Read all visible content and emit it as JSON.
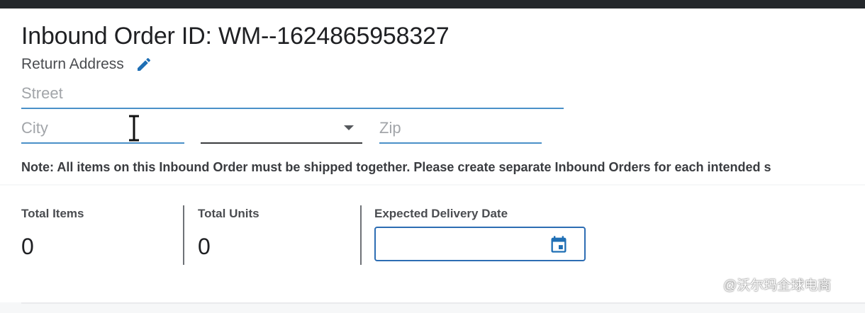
{
  "header": {
    "title": "Inbound Order ID: WM--1624865958327"
  },
  "return_address": {
    "label": "Return Address",
    "edit_icon": "pencil-icon",
    "street": {
      "placeholder": "Street",
      "value": ""
    },
    "city": {
      "placeholder": "City",
      "value": ""
    },
    "state": {
      "value": ""
    },
    "zip": {
      "placeholder": "Zip",
      "value": ""
    },
    "dropdown_icon": "caret-down-icon"
  },
  "note": "Note: All items on this Inbound Order must be shipped together. Please create separate Inbound Orders for each intended s",
  "summary": {
    "total_items": {
      "label": "Total Items",
      "value": "0"
    },
    "total_units": {
      "label": "Total Units",
      "value": "0"
    },
    "expected_delivery": {
      "label": "Expected Delivery Date",
      "value": "",
      "icon": "calendar-icon"
    }
  },
  "watermark": "@沃尔玛全球电商",
  "colors": {
    "accent": "#2d6db3",
    "input_underline": "#4a90c8",
    "topbar": "#24272b",
    "icon_blue": "#1f6fb5"
  }
}
